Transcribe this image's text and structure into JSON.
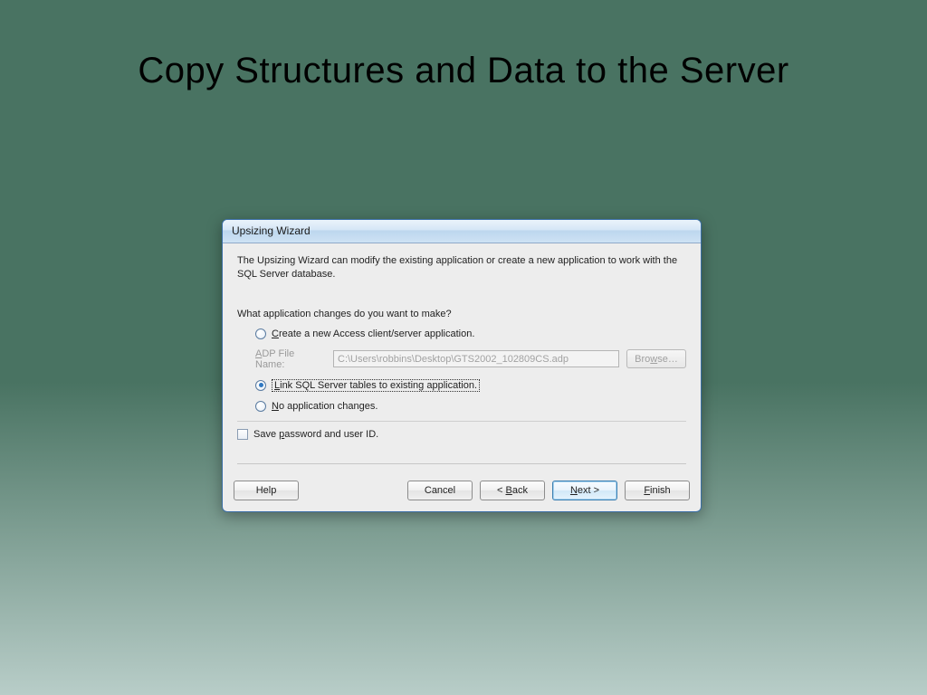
{
  "slide": {
    "title": "Copy Structures and Data to the Server"
  },
  "dialog": {
    "title": "Upsizing  Wizard",
    "intro": "The Upsizing Wizard can modify the existing application or create a new application to work with the SQL Server database.",
    "question": "What application changes do you want to make?",
    "options": {
      "create_new": "Create a new Access client/server application.",
      "link_tables": "Link SQL Server tables to existing application.",
      "no_changes": "No application changes."
    },
    "file": {
      "label": "ADP File Name:",
      "value": "C:\\Users\\robbins\\Desktop\\GTS2002_102809CS.adp",
      "browse": "Browse…"
    },
    "save_pw": "Save password and user ID.",
    "buttons": {
      "help": "Help",
      "cancel": "Cancel",
      "back": "< Back",
      "next": "Next >",
      "finish": "Finish"
    }
  }
}
